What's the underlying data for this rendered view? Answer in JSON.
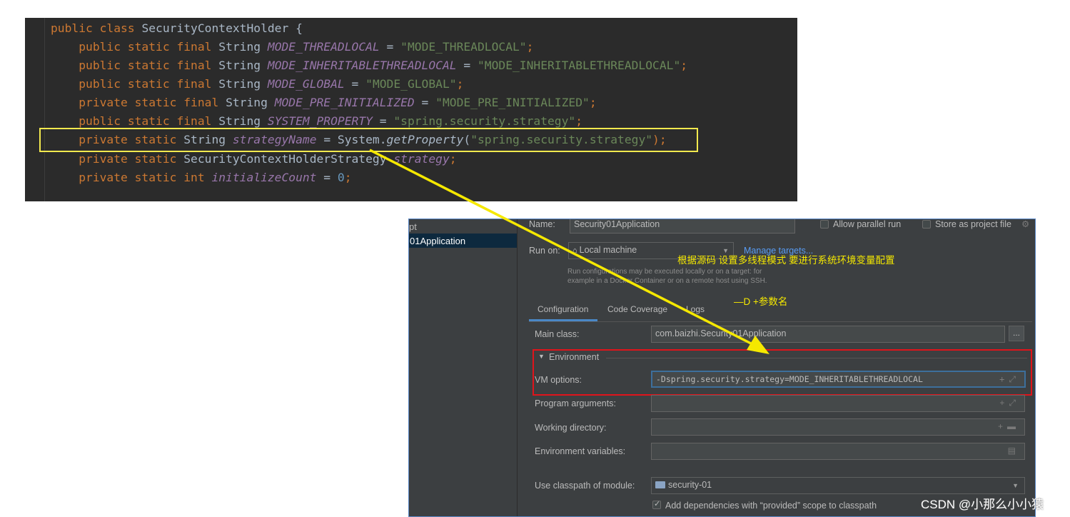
{
  "code": {
    "lines": [
      [
        {
          "t": "public class ",
          "c": "kw"
        },
        {
          "t": "SecurityContextHolder {",
          "c": "pl"
        }
      ],
      [
        {
          "t": "    public static final ",
          "c": "kw"
        },
        {
          "t": "String ",
          "c": "ty"
        },
        {
          "t": "MODE_THREADLOCAL",
          "c": "fd"
        },
        {
          "t": " = ",
          "c": "pl"
        },
        {
          "t": "\"MODE_THREADLOCAL\"",
          "c": "st"
        },
        {
          "t": ";",
          "c": "pu"
        }
      ],
      [
        {
          "t": "    public static final ",
          "c": "kw"
        },
        {
          "t": "String ",
          "c": "ty"
        },
        {
          "t": "MODE_INHERITABLETHREADLOCAL",
          "c": "fd"
        },
        {
          "t": " = ",
          "c": "pl"
        },
        {
          "t": "\"MODE_INHERITABLETHREADLOCAL\"",
          "c": "st"
        },
        {
          "t": ";",
          "c": "pu"
        }
      ],
      [
        {
          "t": "    public static final ",
          "c": "kw"
        },
        {
          "t": "String ",
          "c": "ty"
        },
        {
          "t": "MODE_GLOBAL",
          "c": "fd"
        },
        {
          "t": " = ",
          "c": "pl"
        },
        {
          "t": "\"MODE_GLOBAL\"",
          "c": "st"
        },
        {
          "t": ";",
          "c": "pu"
        }
      ],
      [
        {
          "t": "    private static final ",
          "c": "kw"
        },
        {
          "t": "String ",
          "c": "ty"
        },
        {
          "t": "MODE_PRE_INITIALIZED",
          "c": "fd"
        },
        {
          "t": " = ",
          "c": "pl"
        },
        {
          "t": "\"MODE_PRE_INITIALIZED\"",
          "c": "st"
        },
        {
          "t": ";",
          "c": "pu"
        }
      ],
      [
        {
          "t": "    public static final ",
          "c": "kw"
        },
        {
          "t": "String ",
          "c": "ty"
        },
        {
          "t": "SYSTEM_PROPERTY",
          "c": "fd"
        },
        {
          "t": " = ",
          "c": "pl"
        },
        {
          "t": "\"spring.security.strategy\"",
          "c": "st"
        },
        {
          "t": ";",
          "c": "pu"
        }
      ],
      [
        {
          "t": "    private static ",
          "c": "kw"
        },
        {
          "t": "String ",
          "c": "ty"
        },
        {
          "t": "strategyName",
          "c": "fd"
        },
        {
          "t": " = System.",
          "c": "pl"
        },
        {
          "t": "getProperty",
          "c": "mc"
        },
        {
          "t": "(",
          "c": "pl"
        },
        {
          "t": "\"spring.security.strategy\"",
          "c": "st"
        },
        {
          "t": ");",
          "c": "pu"
        }
      ],
      [
        {
          "t": "    private static ",
          "c": "kw"
        },
        {
          "t": "SecurityContextHolderStrategy ",
          "c": "ty"
        },
        {
          "t": "strategy",
          "c": "fd"
        },
        {
          "t": ";",
          "c": "pu"
        }
      ],
      [
        {
          "t": "    private static int ",
          "c": "kw"
        },
        {
          "t": "initializeCount",
          "c": "fd"
        },
        {
          "t": " = ",
          "c": "pl"
        },
        {
          "t": "0",
          "c": "nm"
        },
        {
          "t": ";",
          "c": "pu"
        }
      ]
    ]
  },
  "dialog": {
    "left_pane": {
      "header": "pt",
      "selected_item": "01Application"
    },
    "name_label": "Name:",
    "name_value": "Security01Application",
    "allow_parallel_label": "Allow parallel run",
    "store_project_label": "Store as project file",
    "run_on_label": "Run on:",
    "run_on_value": "Local machine",
    "manage_targets": "Manage targets...",
    "run_on_help_1": "Run configurations may be executed locally or on a target: for",
    "run_on_help_2": "example in a Docker Container or on a remote host using SSH.",
    "tabs": [
      "Configuration",
      "Code Coverage",
      "Logs"
    ],
    "main_class_label": "Main class:",
    "main_class_value": "com.baizhi.Security01Application",
    "browse_label": "...",
    "environment_label": "Environment",
    "vm_options_label": "VM options:",
    "vm_options_value": "-Dspring.security.strategy=MODE_INHERITABLETHREADLOCAL",
    "program_args_label": "Program arguments:",
    "working_dir_label": "Working directory:",
    "env_vars_label": "Environment variables:",
    "classpath_label": "Use classpath of module:",
    "classpath_value": "security-01",
    "add_deps_label": "Add dependencies with “provided” scope to classpath"
  },
  "annotations": {
    "note1": "根据源码 设置多线程模式 要进行系统环境变量配置",
    "note2": "—D +参数名"
  },
  "watermark": "CSDN @小那么小小猿",
  "colors": {
    "highlight_box": "#f2e94e",
    "env_box": "#e0141b",
    "arrow": "#f5e800"
  }
}
